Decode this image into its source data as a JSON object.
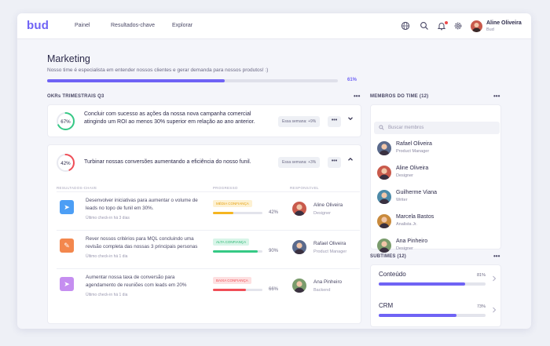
{
  "app": {
    "logo": "bud"
  },
  "nav": {
    "items": [
      "Painel",
      "Resultados-chave",
      "Explorar"
    ]
  },
  "user": {
    "name": "Aline Oliveira",
    "company": "Bud"
  },
  "team": {
    "title": "Marketing",
    "description": "Nosso time é especialista em entender nossos clientes e gerar demanda para nossos produtos! :)",
    "progress_pct": 61,
    "progress_label": "61%"
  },
  "okrs": {
    "section_label": "OKRs TRIMESTRAIS Q3",
    "more": "•••",
    "items": [
      {
        "pct": 67,
        "pct_label": "67%",
        "color": "#35c985",
        "title": "Concluir com sucesso as ações da nossa nova campanha comercial atingindo um ROI ao menos 30% superior em relação ao ano anterior.",
        "week": "Essa semana: +9%",
        "chevron": "⌄"
      },
      {
        "pct": 42,
        "pct_label": "42%",
        "color": "#f04e57",
        "title": "Turbinar nossas conversões aumentando a eficiência do nosso funil.",
        "week": "Essa semana: +3%",
        "chevron": "⌃"
      }
    ],
    "columns": {
      "kr": "RESULTADOS-CHAVE",
      "progress": "PROGRESSO",
      "owner": "RESPONSÁVEL"
    },
    "key_results": [
      {
        "icon": "send-icon",
        "icon_glyph": "➤",
        "icon_color": "#4c9ef5",
        "text": "Desenvolver iniciativas para aumentar o volume de leads no topo de funil em 30%.",
        "checkin": "Último check-in há 3 dias",
        "badge": "MÉDIA CONFIANÇA",
        "badge_bg": "#fdf1d2",
        "badge_fg": "#e7a213",
        "progress": 42,
        "progress_label": "42%",
        "bar_color": "#f5b520",
        "owner": "Aline Oliveira",
        "role": "Designer",
        "avatar_color": "#c95a4c"
      },
      {
        "icon": "comment-icon",
        "icon_glyph": "✎",
        "icon_color": "#f3874d",
        "text": "Rever nossos critérios para MQL concluindo uma revisão completa das nossas 3 principais personas",
        "checkin": "Último check-in há 1 dia",
        "badge": "ALTA CONFIANÇA",
        "badge_bg": "#d8f5e8",
        "badge_fg": "#2bb673",
        "progress": 90,
        "progress_label": "90%",
        "bar_color": "#35c985",
        "owner": "Rafael Oliveira",
        "role": "Product Manager",
        "avatar_color": "#5a6a8c"
      },
      {
        "icon": "send-icon",
        "icon_glyph": "➤",
        "icon_color": "#c58ef0",
        "text": "Aumentar nossa taxa de conversão para agendamento de reuniões com leads em 20%",
        "checkin": "Último check-in há 1 dia",
        "badge": "BAIXA CONFIANÇA",
        "badge_bg": "#fde0e1",
        "badge_fg": "#f04e57",
        "progress": 66,
        "progress_label": "66%",
        "bar_color": "#f04e57",
        "owner": "Ana Pinheiro",
        "role": "Backend",
        "avatar_color": "#7a9c6c"
      }
    ]
  },
  "members": {
    "section_label": "MEMBROS DO TIME (12)",
    "more": "•••",
    "search_placeholder": "Buscar membros",
    "list": [
      {
        "name": "Rafael Oliveira",
        "role": "Product Manager",
        "avatar_color": "#5a6a8c"
      },
      {
        "name": "Aline Oliveira",
        "role": "Designer",
        "avatar_color": "#c95a4c"
      },
      {
        "name": "Guilherme Viana",
        "role": "Writer",
        "avatar_color": "#4c8aa8"
      },
      {
        "name": "Marcela Bastos",
        "role": "Analista Jr.",
        "avatar_color": "#c98a3c"
      },
      {
        "name": "Ana Pinheiro",
        "role": "Designer",
        "avatar_color": "#7a9c6c"
      }
    ]
  },
  "subteams": {
    "section_label": "SUBTIMES (12)",
    "more": "•••",
    "list": [
      {
        "name": "Conteúdo",
        "pct": 81,
        "pct_label": "81%"
      },
      {
        "name": "CRM",
        "pct": 73,
        "pct_label": "73%"
      }
    ]
  }
}
